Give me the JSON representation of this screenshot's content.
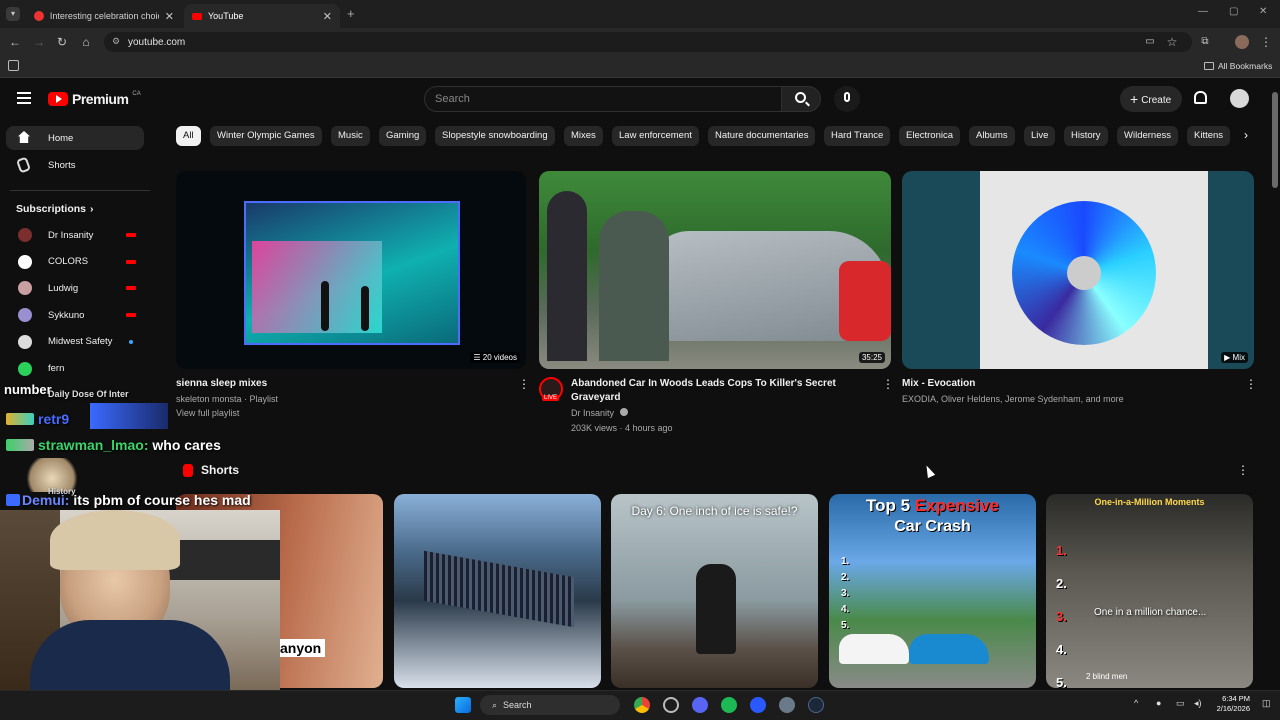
{
  "browser": {
    "tabs": [
      {
        "label": "Interesting celebration choice b",
        "active": false
      },
      {
        "label": "YouTube",
        "active": true
      }
    ],
    "url": "youtube.com",
    "bookmarks_label": "All Bookmarks"
  },
  "header": {
    "logo": "Premium",
    "region": "CA",
    "search_placeholder": "Search",
    "create_label": "Create"
  },
  "chips": [
    "All",
    "Winter Olympic Games",
    "Music",
    "Gaming",
    "Slopestyle snowboarding",
    "Mixes",
    "Law enforcement",
    "Nature documentaries",
    "Hard Trance",
    "Electronica",
    "Albums",
    "Live",
    "History",
    "Wilderness",
    "Kittens"
  ],
  "sidebar": {
    "home": "Home",
    "shorts": "Shorts",
    "subscriptions_label": "Subscriptions",
    "subscriptions": [
      {
        "name": "Dr Insanity",
        "live": true,
        "color": "#7a2e2e"
      },
      {
        "name": "COLORS",
        "live": true,
        "color": "#ffffff"
      },
      {
        "name": "Ludwig",
        "live": true,
        "color": "#c9a0a0"
      },
      {
        "name": "Sykkuno",
        "live": true,
        "color": "#9a8fd0"
      },
      {
        "name": "Midwest Safety",
        "live": false,
        "color": "#dddddd"
      },
      {
        "name": "fern",
        "live": false,
        "color": "#2bd05a"
      }
    ]
  },
  "videos": [
    {
      "title": "sienna sleep mixes",
      "meta1": "skeleton monsta · Playlist",
      "meta2": "View full playlist",
      "badge": "20 videos"
    },
    {
      "title_line1": "Abandoned Car In Woods Leads Cops To Killer's Secret",
      "title_line2": "Graveyard",
      "channel": "Dr Insanity",
      "stats": "203K views · 4 hours ago",
      "duration": "35:25",
      "live_label": "LIVE"
    },
    {
      "title": "Mix - Evocation",
      "meta1": "EXODIA, Oliver Heldens, Jerome Sydenham, and more",
      "badge": "Mix"
    }
  ],
  "shorts_section": {
    "title": "Shorts",
    "items": [
      {
        "caption": "anyon"
      },
      {
        "caption": ""
      },
      {
        "caption": "Day 6: One inch of ice is safe!?"
      },
      {
        "caption_a": "Top 5",
        "caption_b": "Expensive",
        "caption_c": "Car Crash",
        "list": [
          "1.",
          "2.",
          "3.",
          "4.",
          "5."
        ]
      },
      {
        "header": "One-in-a-Million Moments",
        "caption": "One in a million chance...",
        "list": [
          "1.",
          "2.",
          "3.",
          "4.",
          "5."
        ],
        "footer": "2 blind men"
      }
    ]
  },
  "overlay_chat": [
    {
      "text": "number",
      "color": "#ffffff"
    },
    {
      "user": "Daily Dose Of Inter",
      "color": "#ffffff"
    },
    {
      "user": "retr9",
      "color": "#4a6bff"
    },
    {
      "user": "strawman_lmao:",
      "msg": "who cares",
      "color": "#3cd46a"
    },
    {
      "user": "History",
      "color": "#ffffff"
    },
    {
      "user": "Demui:",
      "msg": "its pbm of course hes mad",
      "color": "#6a86ff"
    }
  ],
  "taskbar": {
    "search_label": "Search",
    "time": "6:34 PM",
    "date": "2/16/2026"
  }
}
